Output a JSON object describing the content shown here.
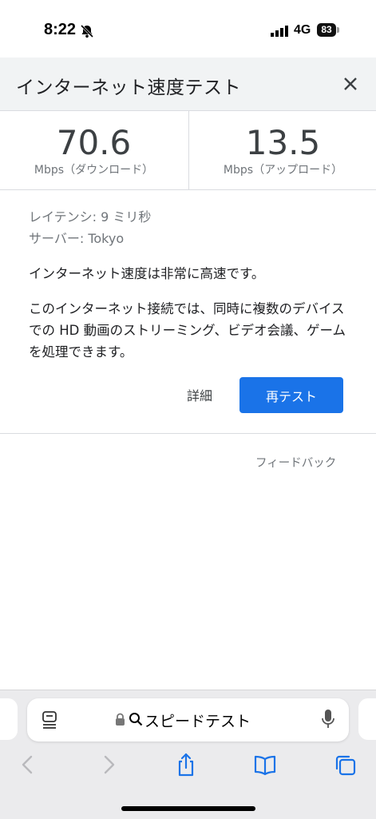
{
  "status_bar": {
    "time": "8:22",
    "network": "4G",
    "battery": "83"
  },
  "header": {
    "title": "インターネット速度テスト"
  },
  "speeds": {
    "download": {
      "value": "70.6",
      "unit": "Mbps（ダウンロード）"
    },
    "upload": {
      "value": "13.5",
      "unit": "Mbps（アップロード）"
    }
  },
  "info": {
    "latency": "レイテンシ: 9 ミリ秒",
    "server": "サーバー: Tokyo"
  },
  "assessment": "インターネット速度は非常に高速です。",
  "description": "このインターネット接続では、同時に複数のデバイスでの HD 動画のストリーミング、ビデオ会議、ゲームを処理できます。",
  "actions": {
    "details": "詳細",
    "retest": "再テスト"
  },
  "feedback": "フィードバック",
  "browser": {
    "url_text": "スピードテスト"
  },
  "colors": {
    "accent": "#1a73e8",
    "header_bg": "#f1f3f4"
  }
}
